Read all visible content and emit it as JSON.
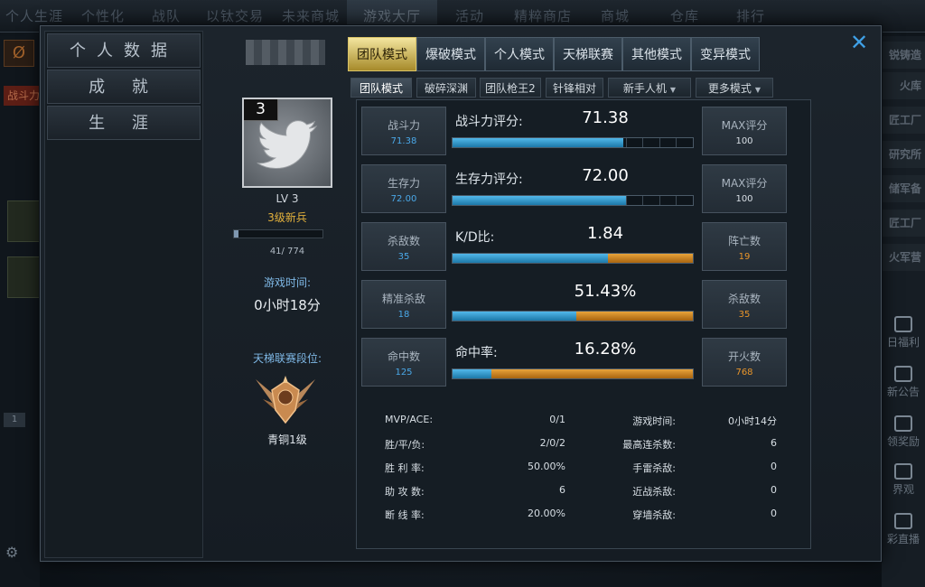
{
  "topnav": [
    "个人生涯",
    "个性化",
    "战队",
    "以钛交易",
    "未来商城",
    "游戏大厅",
    "活动",
    "精粹商店",
    "商城",
    "仓库",
    "排行"
  ],
  "topnav_active": 5,
  "right_sidebar": [
    "锐铸造",
    "火库",
    "匠工厂",
    "研究所",
    "储军备",
    "匠工厂",
    "火军营"
  ],
  "right_icons": [
    "日福利",
    "新公告",
    "领奖励",
    "界观",
    "彩直播"
  ],
  "left_sidebar": {
    "badge_text": "战斗力",
    "tab": "1"
  },
  "close_label": "✕",
  "left_menu": [
    {
      "label": "个人数据",
      "active": true
    },
    {
      "label": "成 就",
      "active": false
    },
    {
      "label": "生 涯",
      "active": false
    }
  ],
  "profile": {
    "avatar_level": "3",
    "level_text": "LV 3",
    "rank_title": "3级新兵",
    "xp_text": "41/ 774",
    "xp_fraction": 0.053,
    "time_label": "游戏时间:",
    "time_value": "0小时18分",
    "ladder_label": "天梯联赛段位:",
    "ladder_rank": "青铜1级"
  },
  "mode_tabs": [
    {
      "label": "团队模式",
      "active": true
    },
    {
      "label": "爆破模式",
      "active": false
    },
    {
      "label": "个人模式",
      "active": false
    },
    {
      "label": "天梯联赛",
      "active": false
    },
    {
      "label": "其他模式",
      "active": false
    },
    {
      "label": "变异模式",
      "active": false
    }
  ],
  "sub_tabs": [
    {
      "label": "团队模式",
      "active": true,
      "dropdown": false
    },
    {
      "label": "破碎深渊",
      "active": false,
      "dropdown": false
    },
    {
      "label": "团队枪王2",
      "active": false,
      "dropdown": false
    },
    {
      "label": "针锋相对",
      "active": false,
      "dropdown": false
    },
    {
      "label": "新手人机",
      "active": false,
      "dropdown": true
    },
    {
      "label": "更多模式",
      "active": false,
      "dropdown": true
    }
  ],
  "stat_rows": [
    {
      "left_title": "战斗力",
      "left_value": "71.38",
      "label": "战斗力评分:",
      "value": "71.38",
      "right_title": "MAX评分",
      "right_value": "100",
      "blue": 0.71,
      "orange": 0,
      "ticks": true
    },
    {
      "left_title": "生存力",
      "left_value": "72.00",
      "label": "生存力评分:",
      "value": "72.00",
      "right_title": "MAX评分",
      "right_value": "100",
      "blue": 0.72,
      "orange": 0,
      "ticks": true
    },
    {
      "left_title": "杀敌数",
      "left_value": "35",
      "label": "K/D比:",
      "value": "1.84",
      "right_title": "阵亡数",
      "right_value": "19",
      "blue": 0.648,
      "orange": 0.352,
      "ticks": false
    },
    {
      "left_title": "精准杀敌",
      "left_value": "18",
      "label": "",
      "value": "51.43%",
      "right_title": "杀敌数",
      "right_value": "35",
      "blue": 0.5143,
      "orange": 0.4857,
      "ticks": false
    },
    {
      "left_title": "命中数",
      "left_value": "125",
      "label": "命中率:",
      "value": "16.28%",
      "right_title": "开火数",
      "right_value": "768",
      "blue": 0.1628,
      "orange": 0.8372,
      "ticks": false
    }
  ],
  "bottom_left": [
    {
      "label": "MVP/ACE:",
      "value": "0/1"
    },
    {
      "label": "胜/平/负:",
      "value": "2/0/2"
    },
    {
      "label": "胜 利 率:",
      "value": "50.00%"
    },
    {
      "label": "助 攻 数:",
      "value": "6"
    },
    {
      "label": "断 线 率:",
      "value": "20.00%"
    }
  ],
  "bottom_right": [
    {
      "label": "游戏时间:",
      "value": "0小时14分"
    },
    {
      "label": "最高连杀数:",
      "value": "6"
    },
    {
      "label": "手雷杀敌:",
      "value": "0"
    },
    {
      "label": "近战杀敌:",
      "value": "0"
    },
    {
      "label": "穿墙杀敌:",
      "value": "0"
    }
  ],
  "colors": {
    "accent_blue": "#3a9fd6",
    "accent_orange": "#d08a1e",
    "gold_tab": "#e6d27a",
    "value_blue": "#4aa8e8",
    "value_gold": "#e9952a"
  }
}
